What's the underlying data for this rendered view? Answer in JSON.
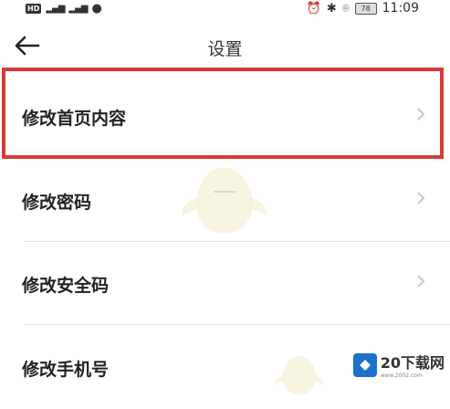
{
  "status_bar": {
    "hd_label": "HD",
    "signal_1": "4G",
    "signal_2": "4G",
    "battery": "78",
    "time": "11:09"
  },
  "header": {
    "title": "设置"
  },
  "menu": {
    "items": [
      {
        "label": "修改首页内容"
      },
      {
        "label": "修改密码"
      },
      {
        "label": "修改安全码"
      },
      {
        "label": "修改手机号"
      }
    ]
  },
  "watermark": {
    "brand": "20下载网",
    "url": "www.2002.com"
  },
  "colors": {
    "highlight": "#d63a3a",
    "divider": "#e6e6e6",
    "text": "#222222",
    "accent_logo": "#1a73c8"
  }
}
